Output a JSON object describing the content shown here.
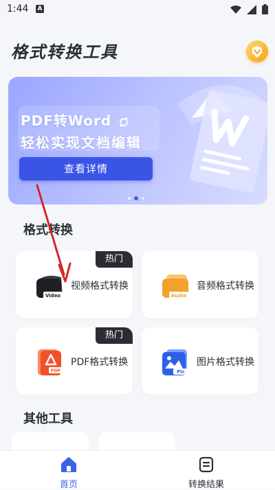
{
  "status_bar": {
    "time": "1:44",
    "notification_glyph": "A",
    "icons": [
      "wifi-icon",
      "signal-icon",
      "battery-icon"
    ]
  },
  "header": {
    "title": "格式转换工具",
    "vip_icon": "vip-crown-icon"
  },
  "banner": {
    "line1": "PDF转Word",
    "line2": "轻松实现文档编辑",
    "button_label": "查看详情",
    "slide_count": 3,
    "active_slide": 2
  },
  "format_section": {
    "title": "格式转换",
    "cards": [
      {
        "label": "视频格式转换",
        "tag": "热门",
        "icon": "video-icon",
        "icon_text": "Video"
      },
      {
        "label": "音频格式转换",
        "tag": "",
        "icon": "audio-icon",
        "icon_text": "Audio"
      },
      {
        "label": "PDF格式转换",
        "tag": "热门",
        "icon": "pdf-icon",
        "icon_text": "PDF"
      },
      {
        "label": "图片格式转换",
        "tag": "",
        "icon": "picture-icon",
        "icon_text": "Pic"
      }
    ]
  },
  "other_section": {
    "title": "其他工具"
  },
  "bottom_nav": {
    "items": [
      {
        "label": "首页",
        "icon": "home-icon",
        "active": true
      },
      {
        "label": "转换结果",
        "icon": "results-icon",
        "active": false
      }
    ]
  },
  "colors": {
    "accent": "#3a63e8",
    "banner_button": "#3a55e6",
    "hot_tag": "#2b2d33",
    "annotation_arrow": "#d32626"
  }
}
